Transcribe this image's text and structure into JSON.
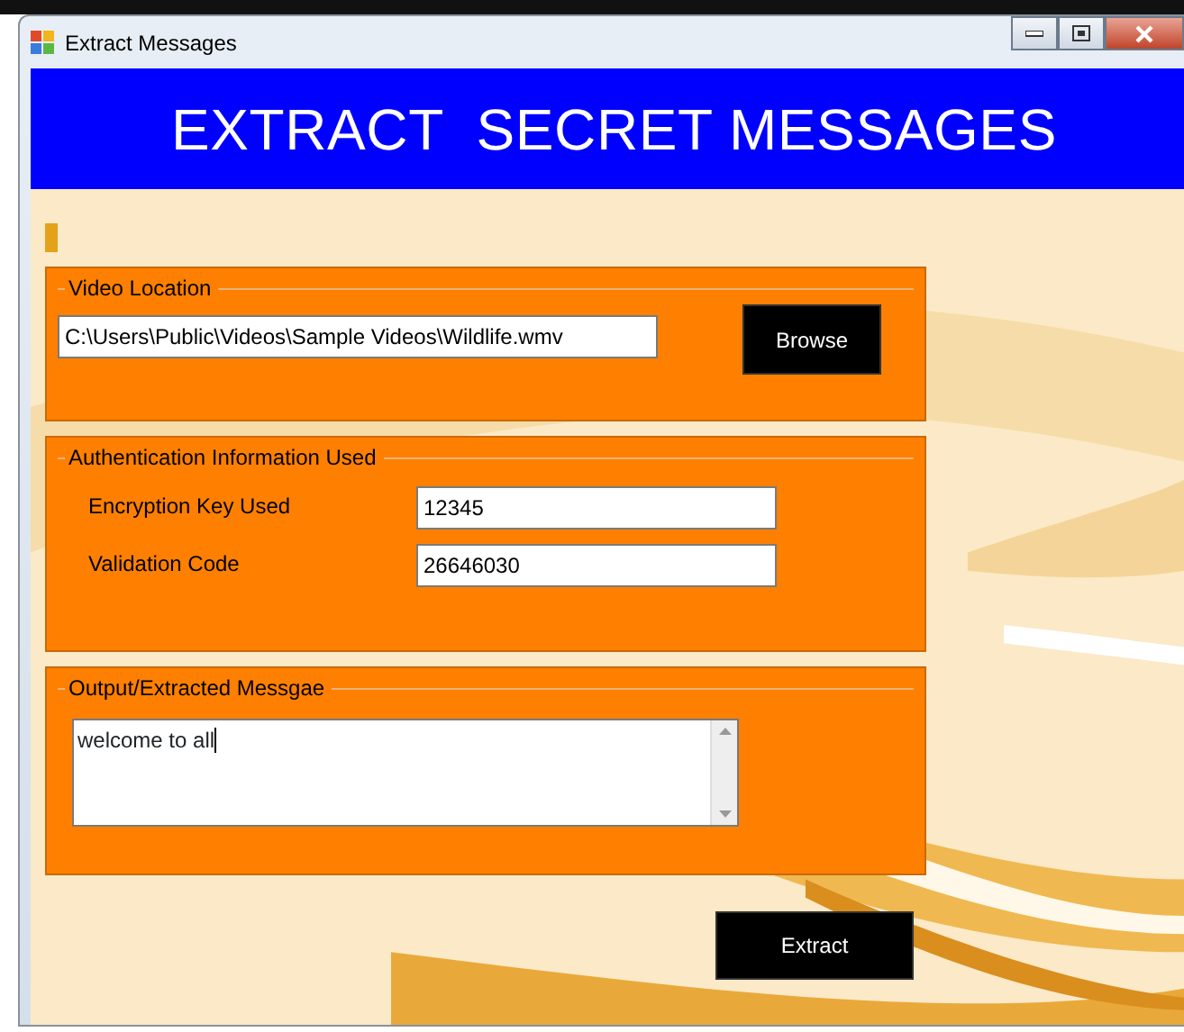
{
  "window": {
    "title": "Extract Messages"
  },
  "header": {
    "title": "EXTRACT  SECRET MESSAGES"
  },
  "video_location": {
    "legend": "Video Location",
    "path": "C:\\Users\\Public\\Videos\\Sample Videos\\Wildlife.wmv",
    "browse_button": "Browse"
  },
  "authentication": {
    "legend": "Authentication Information Used",
    "fields": [
      {
        "label": "Encryption Key Used",
        "value": "12345"
      },
      {
        "label": "Validation Code",
        "value": "26646030"
      }
    ]
  },
  "output": {
    "legend": "Output/Extracted Messgae",
    "message": "welcome to all"
  },
  "extract_button": "Extract"
}
